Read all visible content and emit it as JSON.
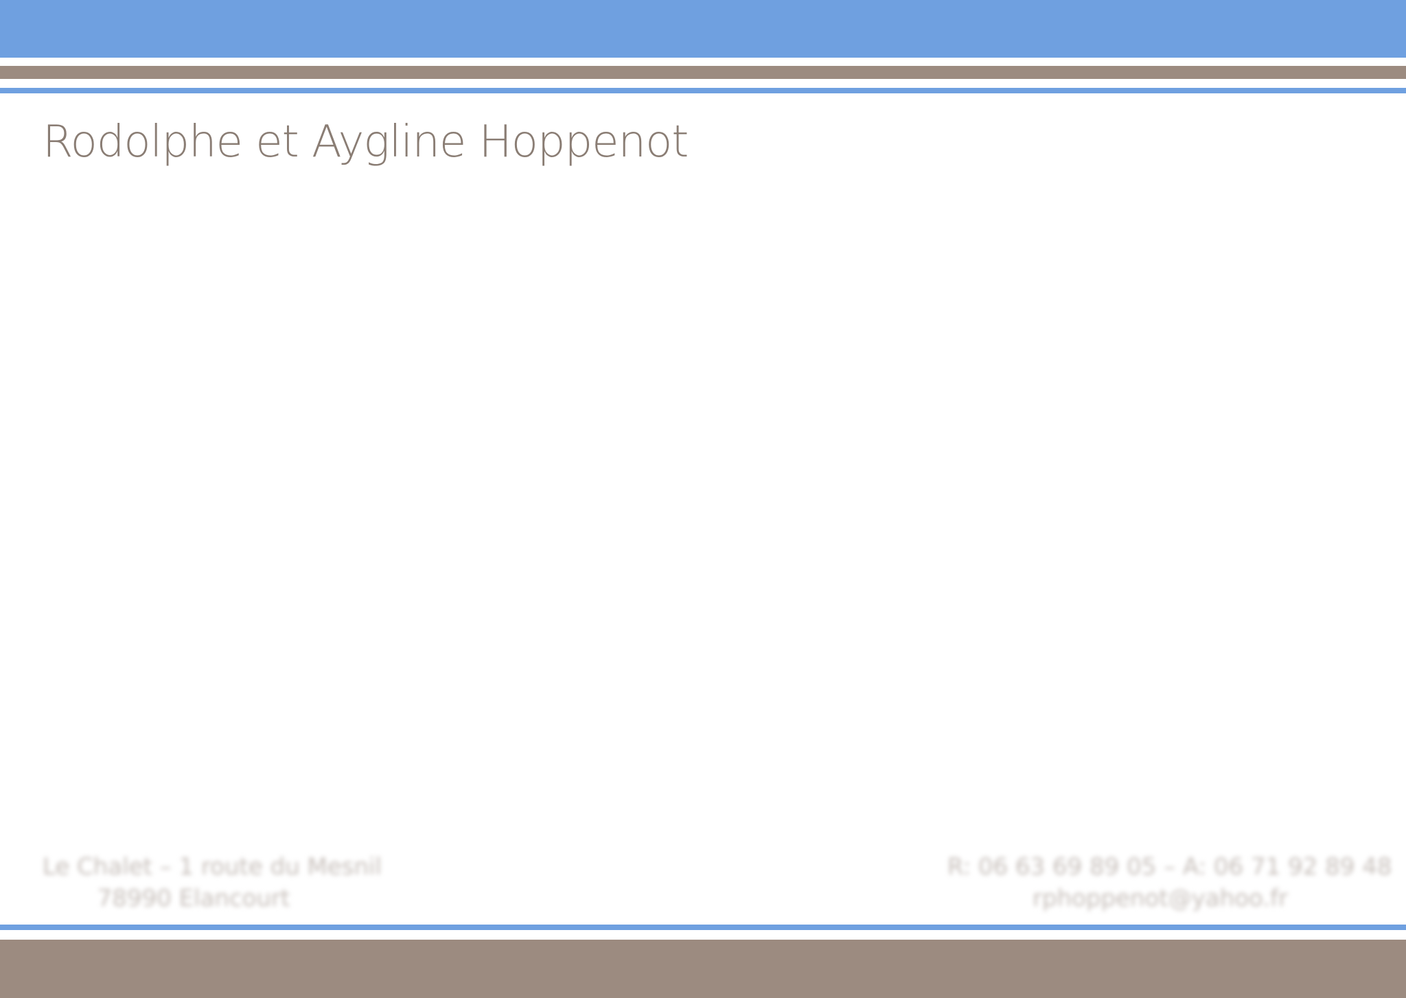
{
  "colors": {
    "blue": "#6fa0e0",
    "brown": "#9c8b80",
    "title_text": "#8a7d74",
    "footer_text": "#c5bdb8",
    "background": "#ffffff"
  },
  "letterhead": {
    "title": "Rodolphe et Aygline Hoppenot"
  },
  "footer": {
    "left": {
      "line1": "Le Chalet – 1 route du Mesnil",
      "line2": "78990 Elancourt"
    },
    "right": {
      "line1": "R: 06 63 69 89 05 – A: 06 71 92 89 48",
      "line2": "rphoppenot@yahoo.fr"
    }
  }
}
